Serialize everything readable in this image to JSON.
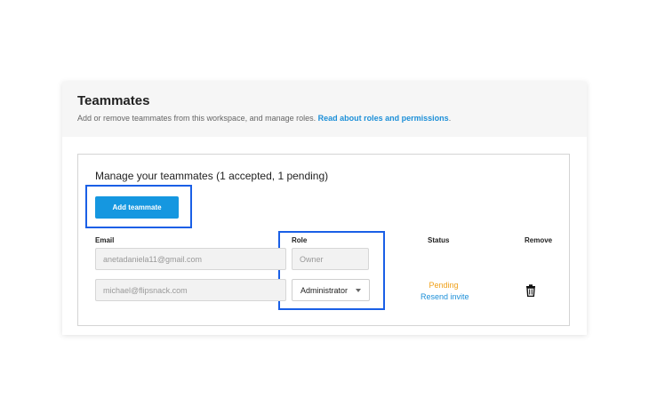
{
  "header": {
    "title": "Teammates",
    "description": "Add or remove teammates from this workspace, and manage roles.",
    "link_text": "Read about roles and permissions",
    "link_suffix": "."
  },
  "panel": {
    "title": "Manage your teammates (1 accepted, 1 pending)",
    "add_button_label": "Add teammate"
  },
  "columns": {
    "email": "Email",
    "role": "Role",
    "status": "Status",
    "remove": "Remove"
  },
  "rows": [
    {
      "email": "anetadaniela11@gmail.com",
      "role": "Owner",
      "status": "",
      "action": ""
    },
    {
      "email": "michael@flipsnack.com",
      "role": "Administrator",
      "status": "Pending",
      "action": "Resend invite"
    }
  ],
  "icons": {
    "remove": "trash-icon",
    "dropdown": "chevron-down-icon"
  },
  "colors": {
    "accent": "#1597e0",
    "link": "#1c8fd8",
    "pending": "#f0a019",
    "highlight": "#1a5fe6"
  }
}
